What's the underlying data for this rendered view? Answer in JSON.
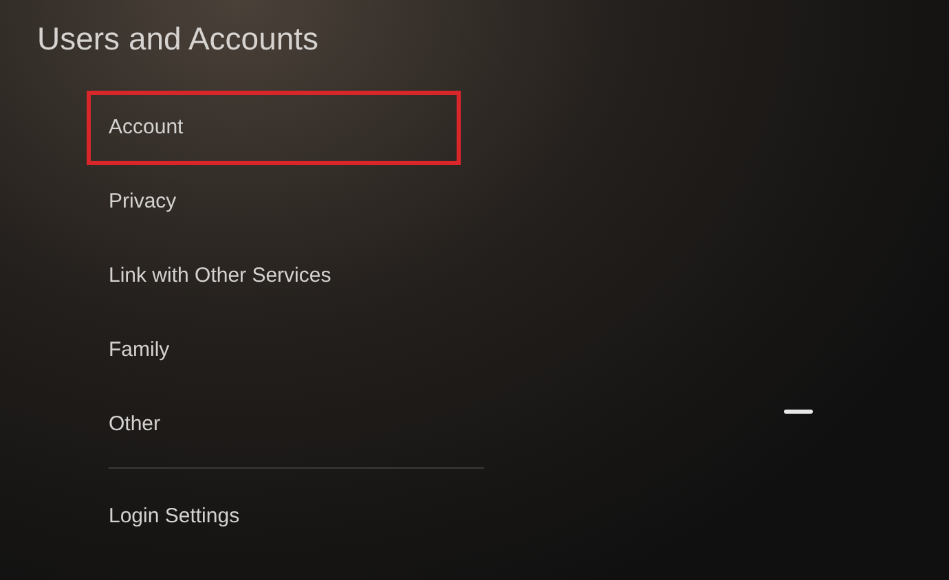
{
  "title": "Users and Accounts",
  "sections": [
    {
      "items": [
        {
          "label": "Account",
          "selected": true
        },
        {
          "label": "Privacy",
          "selected": false
        },
        {
          "label": "Link with Other Services",
          "selected": false
        },
        {
          "label": "Family",
          "selected": false
        },
        {
          "label": "Other",
          "selected": false
        }
      ]
    },
    {
      "items": [
        {
          "label": "Login Settings",
          "selected": false
        }
      ]
    }
  ]
}
